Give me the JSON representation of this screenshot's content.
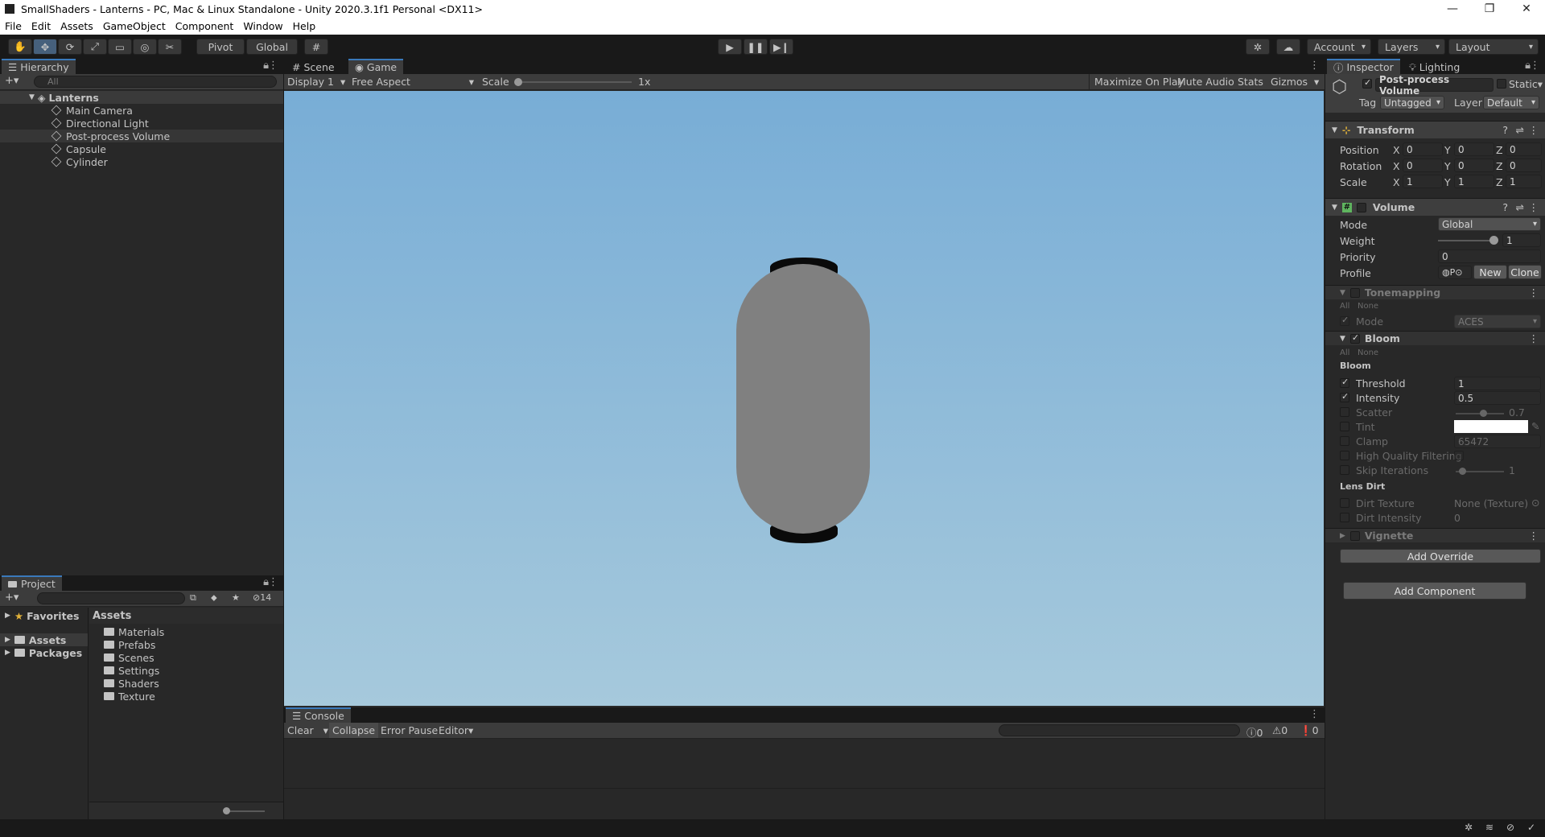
{
  "window": {
    "title": "SmallShaders - Lanterns - PC, Mac & Linux Standalone - Unity 2020.3.1f1 Personal <DX11>",
    "controls": {
      "minimize": "—",
      "maximize": "❐",
      "close": "✕"
    }
  },
  "menu": [
    "File",
    "Edit",
    "Assets",
    "GameObject",
    "Component",
    "Window",
    "Help"
  ],
  "toolbar": {
    "pivot": "Pivot",
    "global": "Global",
    "account": "Account",
    "layers": "Layers",
    "layout": "Layout"
  },
  "hierarchy": {
    "tab": "Hierarchy",
    "search_placeholder": "All",
    "scene": "Lanterns",
    "items": [
      "Main Camera",
      "Directional Light",
      "Post-process Volume",
      "Capsule",
      "Cylinder"
    ],
    "selected": "Post-process Volume"
  },
  "project": {
    "tab": "Project",
    "hidden_count": "14",
    "favorites": "Favorites",
    "tree": [
      "Assets",
      "Packages"
    ],
    "breadcrumb": "Assets",
    "folders": [
      "Materials",
      "Prefabs",
      "Scenes",
      "Settings",
      "Shaders",
      "Texture"
    ]
  },
  "center": {
    "tabs": [
      "Scene",
      "Game"
    ],
    "display": "Display 1",
    "aspect": "Free Aspect",
    "scale_label": "Scale",
    "scale_value": "1x",
    "right_buttons": [
      "Maximize On Play",
      "Mute Audio",
      "Stats",
      "Gizmos"
    ],
    "sky_top": "#78add6",
    "sky_bottom": "#a6c9dc",
    "lantern_color": "#808080"
  },
  "console": {
    "tab": "Console",
    "clear": "Clear",
    "collapse": "Collapse",
    "error_pause": "Error Pause",
    "editor": "Editor",
    "counts": [
      "0",
      "0",
      "0"
    ]
  },
  "inspector": {
    "tabs": [
      "Inspector",
      "Lighting"
    ],
    "object_name": "Post-process Volume",
    "static_label": "Static",
    "tag_label": "Tag",
    "tag_value": "Untagged",
    "layer_label": "Layer",
    "layer_value": "Default",
    "transform": {
      "title": "Transform",
      "rows": [
        {
          "label": "Position",
          "x": "0",
          "y": "0",
          "z": "0"
        },
        {
          "label": "Rotation",
          "x": "0",
          "y": "0",
          "z": "0"
        },
        {
          "label": "Scale",
          "x": "1",
          "y": "1",
          "z": "1"
        }
      ]
    },
    "volume": {
      "title": "Volume",
      "mode_label": "Mode",
      "mode_value": "Global",
      "weight_label": "Weight",
      "weight_value": "1",
      "weight_fraction": 1,
      "priority_label": "Priority",
      "priority_value": "0",
      "profile_label": "Profile",
      "profile_value": "P",
      "new_label": "New",
      "clone_label": "Clone"
    },
    "tonemapping": {
      "title": "Tonemapping",
      "all": "All",
      "none": "None",
      "mode_label": "Mode",
      "mode_value": "ACES"
    },
    "bloom": {
      "title": "Bloom",
      "all": "All",
      "none": "None",
      "section_bloom": "Bloom",
      "threshold_label": "Threshold",
      "threshold_value": "1",
      "intensity_label": "Intensity",
      "intensity_value": "0.5",
      "scatter_label": "Scatter",
      "scatter_value": "0.7",
      "tint_label": "Tint",
      "clamp_label": "Clamp",
      "clamp_value": "65472",
      "hq_label": "High Quality Filtering",
      "skip_label": "Skip Iterations",
      "skip_value": "1",
      "section_lens": "Lens Dirt",
      "dirt_texture_label": "Dirt Texture",
      "dirt_texture_value": "None (Texture)",
      "dirt_intensity_label": "Dirt Intensity",
      "dirt_intensity_value": "0"
    },
    "vignette": {
      "title": "Vignette"
    },
    "add_override": "Add Override",
    "add_component": "Add Component"
  }
}
